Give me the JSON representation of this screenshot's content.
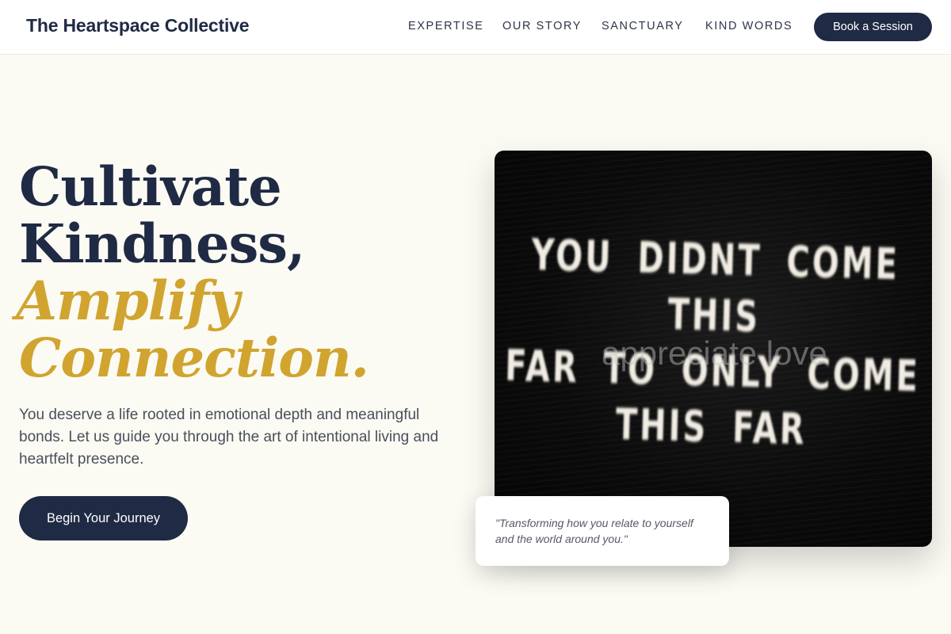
{
  "header": {
    "brand": "The Heartspace Collective",
    "nav": [
      "EXPERTISE",
      "OUR STORY",
      "SANCTUARY",
      "KIND WORDS"
    ],
    "cta_label": "Book a Session"
  },
  "hero": {
    "headline_lines": [
      "Cultivate",
      "Kindness,"
    ],
    "accent_lines": [
      "Amplify",
      "Connection."
    ],
    "subtext": "You deserve a life rooted in emotional depth and meaningful bonds. Let us guide you through the art of intentional living and heartfelt presence.",
    "cta_label": "Begin Your Journey"
  },
  "image": {
    "sign_lines": [
      "YOU DIDNT COME THIS",
      "FAR TO ONLY COME",
      "THIS FAR"
    ],
    "alt_text": "appreciate love"
  },
  "quote": {
    "text": "\"Transforming how you relate to yourself and the world around you.\""
  },
  "colors": {
    "navy": "#1f2a44",
    "gold": "#d0a42f",
    "background": "#fbfaf3"
  }
}
